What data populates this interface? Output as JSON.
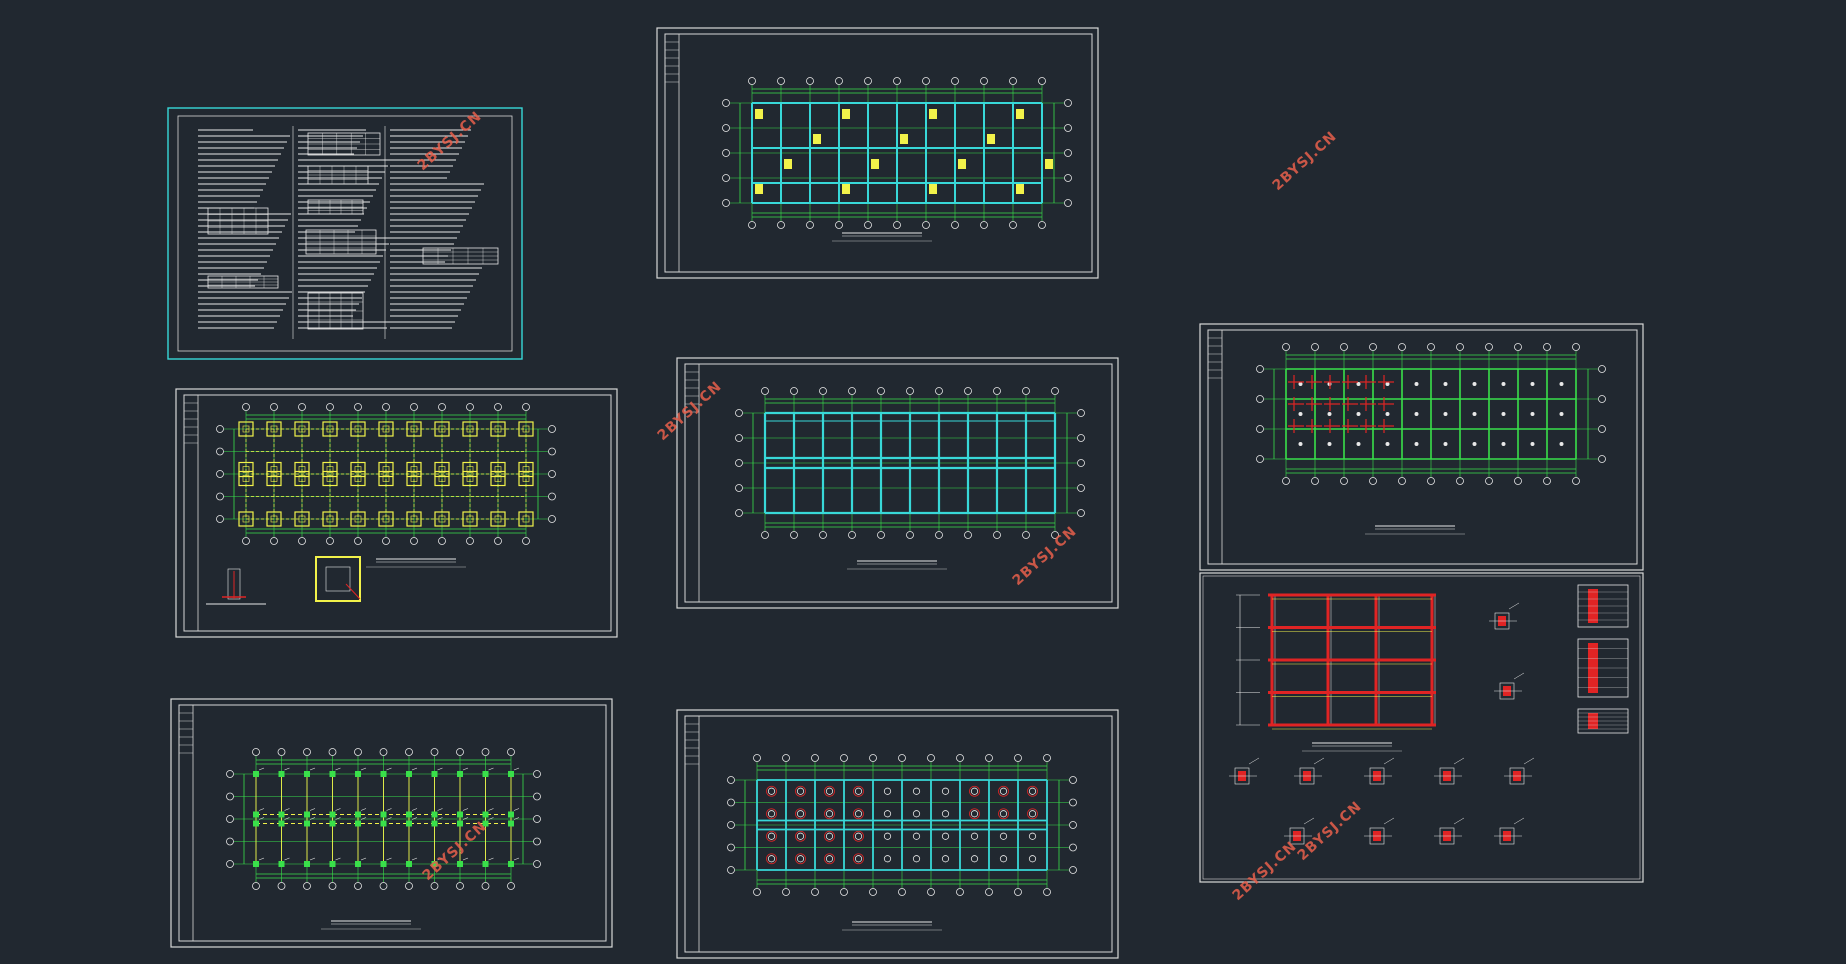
{
  "viewport": {
    "background": "#212830"
  },
  "colors": {
    "frame": "#d8d8d8",
    "grid_green": "#39e04a",
    "beam_cyan": "#38d8d8",
    "column_yellow": "#f2f24a",
    "rebar_red": "#e02424",
    "text_white": "#e8e8e8",
    "watermark": "#e8604c"
  },
  "watermarks": [
    {
      "id": "wm1",
      "text": "2BYSJ.CN"
    },
    {
      "id": "wm2",
      "text": "2BYSJ.CN"
    },
    {
      "id": "wm3",
      "text": "2BYSJ.CN"
    },
    {
      "id": "wm4",
      "text": "2BYSJ.CN"
    },
    {
      "id": "wm5",
      "text": "2BYSJ.CN"
    },
    {
      "id": "wm6",
      "text": "2BYSJ.CN"
    },
    {
      "id": "wm7",
      "text": "2BYSJ.CN"
    }
  ],
  "sheets": [
    {
      "id": "general-notes",
      "kind": "notes"
    },
    {
      "id": "floor-plan-top",
      "kind": "plan-beams"
    },
    {
      "id": "foundation-plan",
      "kind": "plan-footings"
    },
    {
      "id": "floor-plan-mid",
      "kind": "plan-cyan"
    },
    {
      "id": "slab-plan",
      "kind": "plan-slab"
    },
    {
      "id": "column-plan",
      "kind": "plan-columns"
    },
    {
      "id": "roof-plan",
      "kind": "plan-roof"
    },
    {
      "id": "frame-detail",
      "kind": "frame"
    }
  ]
}
